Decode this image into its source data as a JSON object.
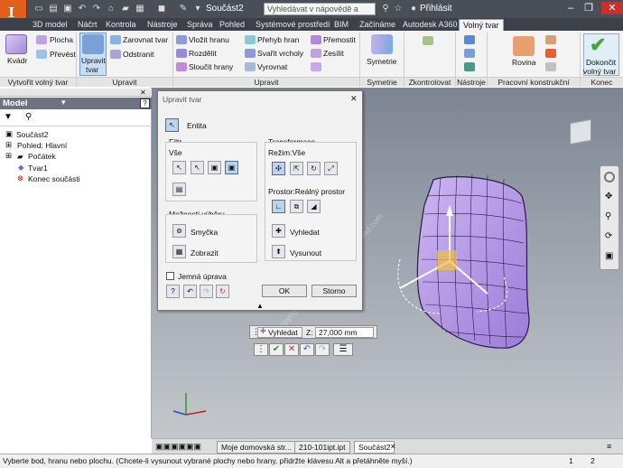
{
  "titlebar": {
    "doc_title": "Součást2",
    "search_placeholder": "Vyhledávat v nápovědě a příkaze",
    "signin": "Přihlásit",
    "app_letter": "I"
  },
  "tabs": [
    "3D model",
    "Náčrt",
    "Kontrola",
    "Nástroje",
    "Správa",
    "Pohled",
    "Systémové prostředí",
    "BIM",
    "Začínáme",
    "Autodesk A360",
    "Volný tvar"
  ],
  "active_tab": "Volný tvar",
  "ribbon": {
    "create": {
      "kvadr": "Kvádr",
      "plocha": "Plocha",
      "prevest": "Převést",
      "title": "Vytvořit volný tvar"
    },
    "edit": {
      "upravit": "Upravit",
      "tvar": "tvar",
      "title": "Upravit"
    },
    "modify": {
      "zarovnat": "Zarovnat tvar",
      "odstranit": "Odstranit",
      "vlozit": "Vložit hranu",
      "rozdelit": "Rozdělit",
      "sloucit": "Sloučit hrany",
      "prehyb": "Přehyb hran",
      "svarit": "Svařit vrcholy",
      "vyrovnat": "Vyrovnat",
      "premostit": "Přemostit",
      "zesilit": "Zesílit",
      "title": "Upravit"
    },
    "symmetry": {
      "label": "Symetrie",
      "title": "Symetrie"
    },
    "convert": {
      "title": "Zkontrolovat"
    },
    "tools": {
      "title": "Nástroje"
    },
    "workfeatures": {
      "rovina": "Rovina",
      "title": "Pracovní konstrukční prvky"
    },
    "finish": {
      "label1": "Dokončit",
      "label2": "volný tvar",
      "title": "Konec"
    }
  },
  "model_panel": {
    "header": "Model",
    "items": [
      "Součást2",
      "Pohled: Hlavní",
      "Počátek",
      "Tvar1",
      "Konec součásti"
    ]
  },
  "dialog": {
    "title": "Upravit tvar",
    "entity": "Entita",
    "filter": "Filtr",
    "filter_all": "Vše",
    "transform": "Transformace",
    "mode": "Režim:Vše",
    "space": "Prostor:Reálný prostor",
    "selection_options": "Možnosti výběru",
    "loop": "Smyčka",
    "show": "Zobrazit",
    "locate": "Vyhledat",
    "extrude": "Vysunout",
    "soft": "Jemná úprava",
    "ok": "OK",
    "cancel": "Storno"
  },
  "floatbar": {
    "locate": "Vyhledat",
    "z_label": "Z:",
    "z_value": "27,000 mm"
  },
  "doctabs": [
    "Moje domovská str...",
    "210-101ipt.ipt",
    "Součást2"
  ],
  "active_doctab": "Součást2",
  "status": {
    "message": "Vyberte bod, hranu nebo plochu. (Chcete-li vysunout vybrané plochy nebo hrany, přidržte klávesu Alt a přetáhněte myší.)",
    "n1": "1",
    "n2": "2"
  },
  "watermark": "Copyright © 2017 - www.p30download.com",
  "colors": {
    "accent": "#6ab04c",
    "shape": "#b598e6",
    "title_bg": "#4a4e55",
    "app": "#e0601c"
  }
}
